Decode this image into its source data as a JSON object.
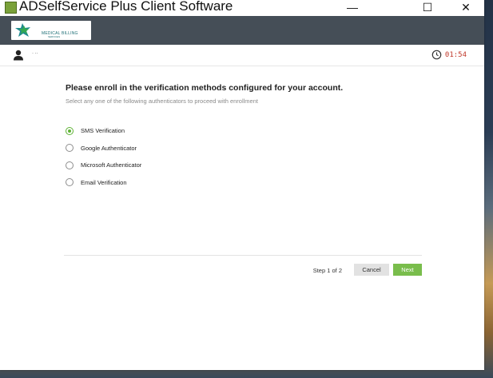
{
  "window": {
    "title": "ADSelfService Plus Client Software",
    "controls": {
      "minimize": "—",
      "maximize": "☐",
      "close": "✕"
    }
  },
  "header": {
    "logo_text": "MEDICAL BILLING",
    "logo_subtext": "SERVICES"
  },
  "user_bar": {
    "username": "· ··",
    "timer": "01:54"
  },
  "enroll": {
    "heading": "Please enroll in the verification methods configured for your account.",
    "subheading": "Select any one of the following authenticators to proceed with enrollment",
    "options": [
      {
        "label": "SMS Verification",
        "selected": true
      },
      {
        "label": "Google Authenticator",
        "selected": false
      },
      {
        "label": "Microsoft Authenticator",
        "selected": false
      },
      {
        "label": "Email Verification",
        "selected": false
      }
    ]
  },
  "footer": {
    "step": "Step 1 of 2",
    "cancel": "Cancel",
    "next": "Next"
  },
  "colors": {
    "header": "#454e57",
    "accent": "#79bd4c",
    "timer": "#c0392b"
  }
}
